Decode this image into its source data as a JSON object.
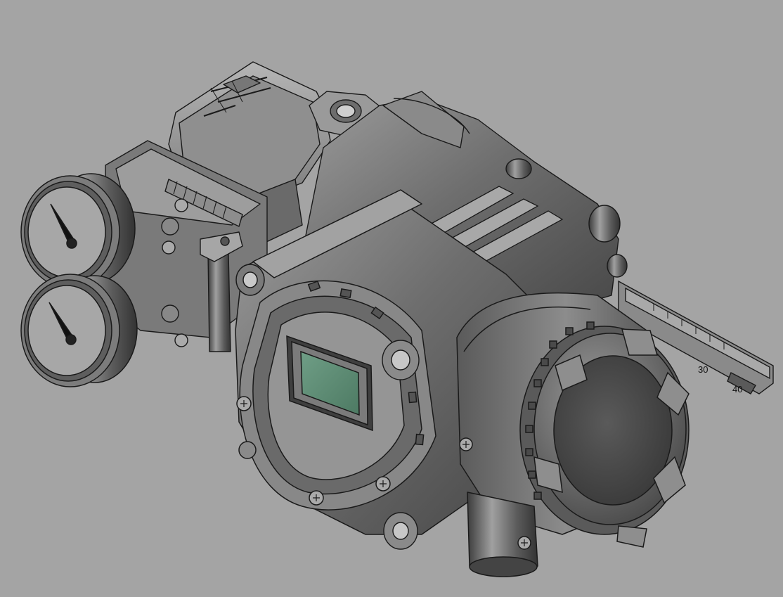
{
  "scale": {
    "tick_labels": [
      "30",
      "40"
    ]
  },
  "colors": {
    "background": "#a4a4a4",
    "body": "#6a6a6a",
    "body_light": "#9a9a9a",
    "body_dark": "#3e3e3e",
    "outline": "#1a1a1a",
    "gauge_face": "#a7a7a7",
    "display_screen": "#5f8f77"
  }
}
